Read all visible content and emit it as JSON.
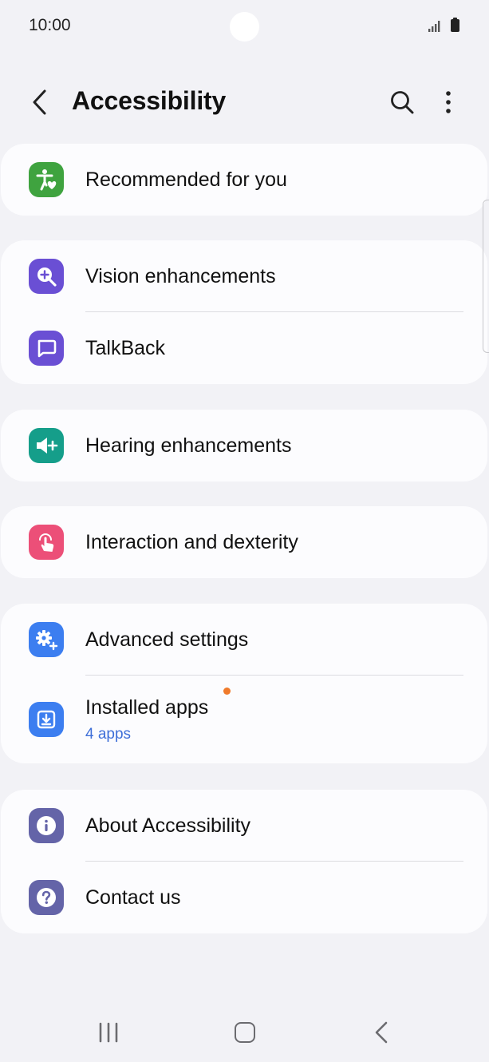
{
  "status": {
    "time": "10:00"
  },
  "header": {
    "title": "Accessibility"
  },
  "sections": [
    {
      "items": [
        {
          "label": "Recommended for you",
          "icon": "accessibility-heart-icon",
          "color": "#3fa33f"
        }
      ]
    },
    {
      "items": [
        {
          "label": "Vision enhancements",
          "icon": "magnifier-plus-icon",
          "color": "#6a4fd4"
        },
        {
          "label": "TalkBack",
          "icon": "speech-bubble-icon",
          "color": "#6a4fd4"
        }
      ]
    },
    {
      "items": [
        {
          "label": "Hearing enhancements",
          "icon": "speaker-plus-icon",
          "color": "#159e8a"
        }
      ]
    },
    {
      "items": [
        {
          "label": "Interaction and dexterity",
          "icon": "touch-hand-icon",
          "color": "#ec4f78"
        }
      ]
    },
    {
      "items": [
        {
          "label": "Advanced settings",
          "icon": "gear-plus-icon",
          "color": "#3c7ef0"
        },
        {
          "label": "Installed apps",
          "sub": "4 apps",
          "icon": "download-box-icon",
          "color": "#3c7ef0",
          "badge_color": "#f07a2b"
        }
      ]
    },
    {
      "items": [
        {
          "label": "About Accessibility",
          "icon": "info-icon",
          "color": "#6464a8"
        },
        {
          "label": "Contact us",
          "icon": "question-icon",
          "color": "#6464a8"
        }
      ]
    }
  ]
}
